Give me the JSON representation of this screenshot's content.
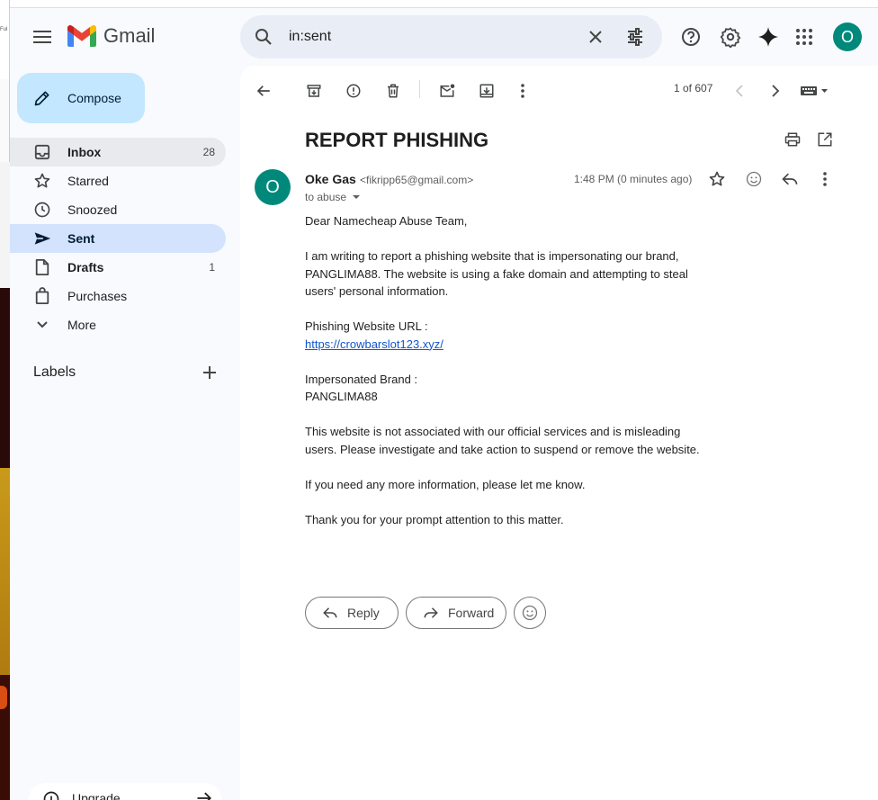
{
  "app": {
    "name": "Gmail"
  },
  "search": {
    "value": "in:sent"
  },
  "account": {
    "initial": "O"
  },
  "compose": {
    "label": "Compose"
  },
  "nav": [
    {
      "label": "Inbox",
      "count": "28"
    },
    {
      "label": "Starred",
      "count": ""
    },
    {
      "label": "Snoozed",
      "count": ""
    },
    {
      "label": "Sent",
      "count": ""
    },
    {
      "label": "Drafts",
      "count": "1"
    },
    {
      "label": "Purchases",
      "count": ""
    },
    {
      "label": "More",
      "count": ""
    }
  ],
  "labels": {
    "title": "Labels"
  },
  "upgrade": {
    "label": "Upgrade"
  },
  "toolbar": {
    "pager": "1 of 607"
  },
  "email": {
    "subject": "REPORT PHISHING",
    "sender_name": "Oke Gas",
    "sender_email": "<fikripp65@gmail.com>",
    "to": "to abuse",
    "time": "1:48 PM (0 minutes ago)",
    "sender_initial": "O",
    "body": {
      "greeting": "Dear Namecheap Abuse Team,",
      "para1": "I am writing to report a phishing website that is impersonating our brand, PANGLIMA88. The website is using a fake domain and attempting to steal users' personal information.",
      "url_label": "Phishing Website URL :",
      "url": "https://crowbarslot123.xyz/",
      "brand_label": "Impersonated Brand :",
      "brand": "PANGLIMA88",
      "para2": "This website is not associated with our official services and is misleading users. Please investigate and take action to suspend or remove the website.",
      "para3": "If you need any more information, please let me know.",
      "closing": "Thank you for your prompt attention to this matter."
    }
  },
  "actions": {
    "reply": "Reply",
    "forward": "Forward"
  },
  "colors": {
    "accent": "#c2e7ff",
    "active_nav": "#d3e3fd",
    "avatar": "#00897b",
    "link": "#1155cc"
  }
}
